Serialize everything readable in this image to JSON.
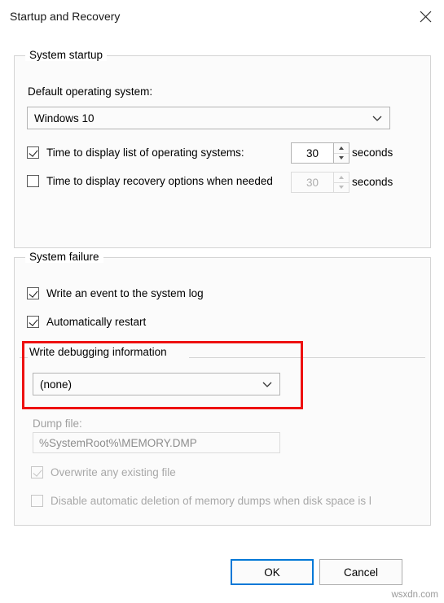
{
  "window": {
    "title": "Startup and Recovery",
    "close_icon": "close-icon"
  },
  "system_startup": {
    "legend": "System startup",
    "default_os_label": "Default operating system:",
    "default_os_value": "Windows 10",
    "timeout_os": {
      "label": "Time to display list of operating systems:",
      "checked": true,
      "value": "30",
      "unit": "seconds"
    },
    "timeout_recovery": {
      "label": "Time to display recovery options when needed",
      "checked": false,
      "value": "30",
      "unit": "seconds"
    }
  },
  "system_failure": {
    "legend": "System failure",
    "write_event": {
      "label": "Write an event to the system log",
      "checked": true
    },
    "auto_restart": {
      "label": "Automatically restart",
      "checked": true
    },
    "write_debugging": {
      "legend": "Write debugging information",
      "value": "(none)"
    },
    "dump_file": {
      "label": "Dump file:",
      "value": "%SystemRoot%\\MEMORY.DMP"
    },
    "overwrite": {
      "label": "Overwrite any existing file",
      "checked": true
    },
    "disable_auto_delete": {
      "label": "Disable automatic deletion of memory dumps when disk space is l",
      "checked": false
    }
  },
  "footer": {
    "ok": "OK",
    "cancel": "Cancel"
  },
  "watermark": "wsxdn.com",
  "colors": {
    "highlight": "#ee1111",
    "accent": "#0078d7"
  }
}
